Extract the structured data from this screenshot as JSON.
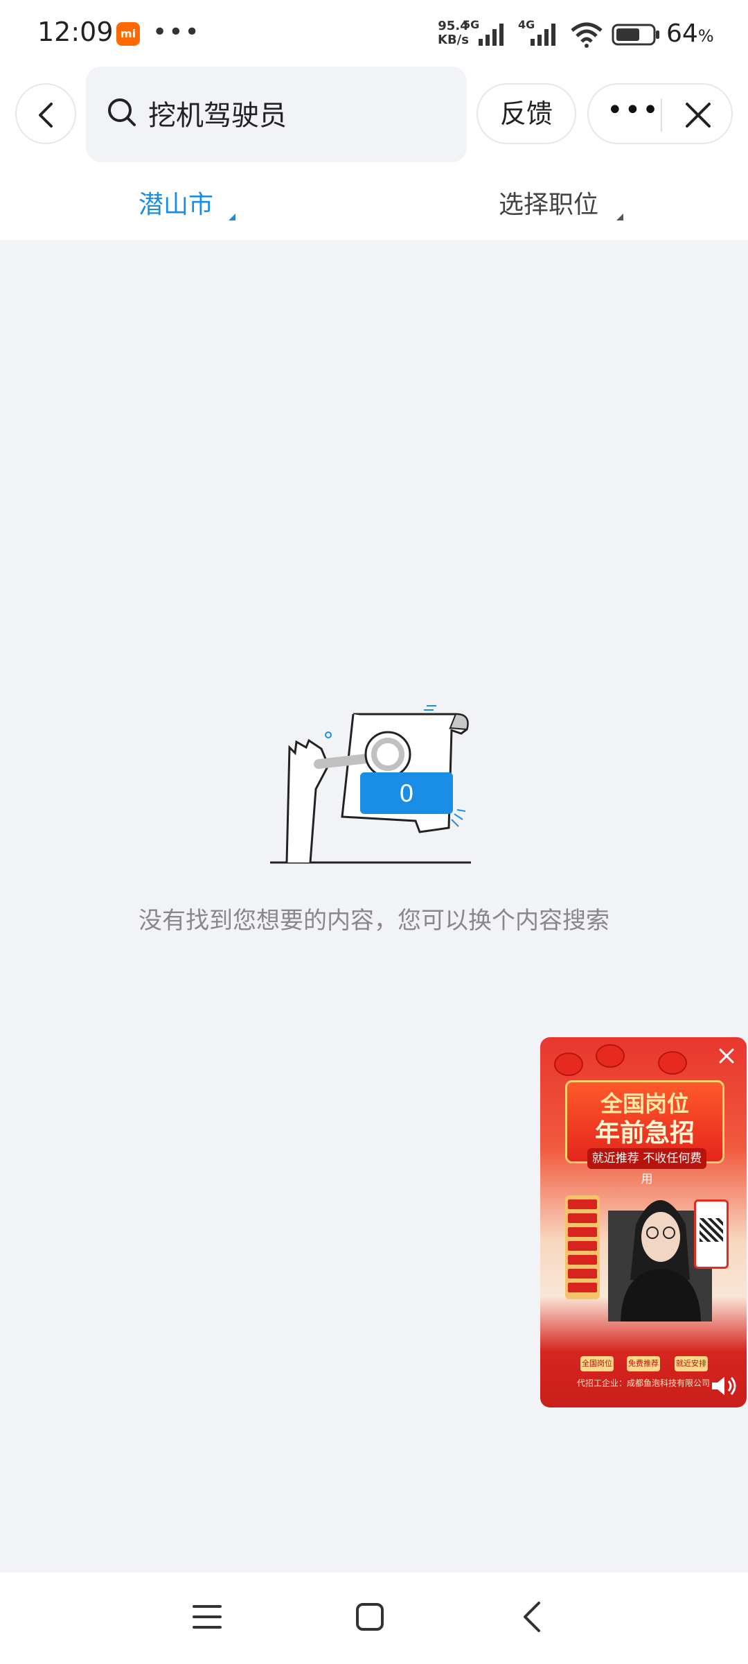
{
  "status_bar": {
    "time": "12:09",
    "network_speed_value": "95.4",
    "network_speed_unit": "KB/s",
    "signal_1_label": "5G",
    "signal_2_label": "4G",
    "battery_percent": "64",
    "battery_unit": "%"
  },
  "search": {
    "query": "挖机驾驶员"
  },
  "header": {
    "feedback_label": "反馈"
  },
  "filters": {
    "city": "潜山市",
    "job": "选择职位"
  },
  "empty_state": {
    "badge_count": "0",
    "message": "没有找到您想要的内容，您可以换个内容搜索"
  },
  "ad": {
    "title_line1": "全国岗位",
    "title_line2": "年前急招",
    "subtitle": "就近推荐 不收任何费用",
    "pills": [
      "全国岗位",
      "免费推荐",
      "就近安排"
    ],
    "footer": "代招工企业：成都鱼泡科技有限公司"
  },
  "colors": {
    "accent": "#1a8ee6",
    "page_bg": "#f2f3f7"
  }
}
